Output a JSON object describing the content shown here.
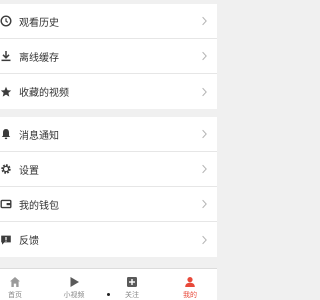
{
  "menu_group_1": [
    {
      "label": "观看历史",
      "icon": "clock-icon"
    },
    {
      "label": "离线缓存",
      "icon": "download-icon"
    },
    {
      "label": "收藏的视频",
      "icon": "star-icon"
    }
  ],
  "menu_group_2": [
    {
      "label": "消息通知",
      "icon": "bell-icon"
    },
    {
      "label": "设置",
      "icon": "gear-icon"
    },
    {
      "label": "我的钱包",
      "icon": "wallet-icon"
    },
    {
      "label": "反馈",
      "icon": "feedback-icon"
    }
  ],
  "tabbar": {
    "home": "首页",
    "short_video": "小视频",
    "follow": "关注",
    "mine": "我的"
  },
  "colors": {
    "accent": "#e8493a",
    "icon": "#3c3c3c",
    "background": "#f0f0f0"
  }
}
